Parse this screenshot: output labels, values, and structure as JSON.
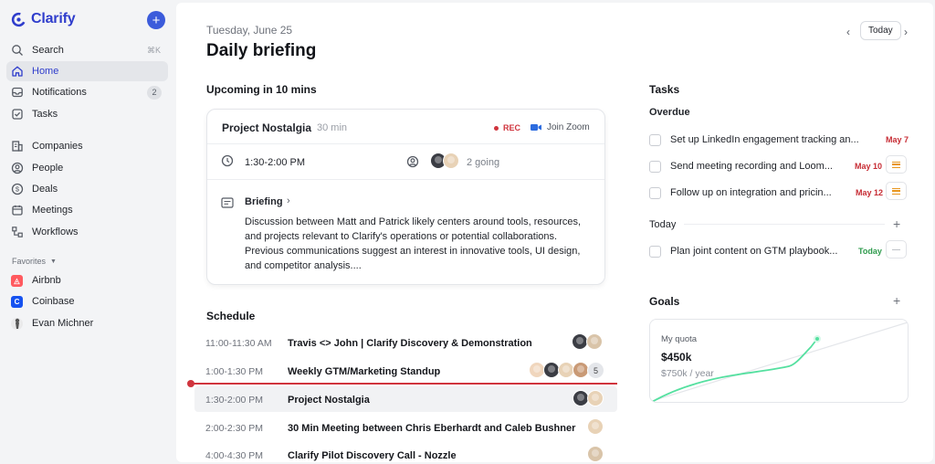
{
  "brand": {
    "name": "Clarify",
    "accent": "#2f3dcc"
  },
  "sidebar": {
    "add_label": "+",
    "items": [
      {
        "label": "Search",
        "icon": "search-icon",
        "shortcut": "⌘K"
      },
      {
        "label": "Home",
        "icon": "home-icon",
        "active": true
      },
      {
        "label": "Notifications",
        "icon": "inbox-icon",
        "badge": "2"
      },
      {
        "label": "Tasks",
        "icon": "checkbox-icon"
      },
      {
        "label": "Companies",
        "icon": "building-icon"
      },
      {
        "label": "People",
        "icon": "person-circle-icon"
      },
      {
        "label": "Deals",
        "icon": "dollar-icon"
      },
      {
        "label": "Meetings",
        "icon": "calendar-icon"
      },
      {
        "label": "Workflows",
        "icon": "workflow-icon"
      }
    ],
    "favorites_label": "Favorites",
    "favorites": [
      {
        "label": "Airbnb",
        "color": "#ff5a5f"
      },
      {
        "label": "Coinbase",
        "color": "#1652f0"
      },
      {
        "label": "Evan Michner"
      }
    ]
  },
  "header": {
    "date": "Tuesday, June 25",
    "title": "Daily briefing",
    "today_button": "Today",
    "prev": "‹",
    "next": "›"
  },
  "upcoming": {
    "heading": "Upcoming in 10 mins",
    "meeting_title": "Project Nostalgia",
    "duration": "30 min",
    "rec_label": "REC",
    "join_label": "Join Zoom",
    "time_range": "1:30-2:00 PM",
    "going": "2 going",
    "briefing_label": "Briefing",
    "briefing_text": "Discussion between Matt and Patrick likely centers around tools, resources, and projects relevant to Clarify's operations or potential collaborations. Previous communications suggest an interest in innovative tools, UI design, and competitor analysis...."
  },
  "schedule": {
    "heading": "Schedule",
    "rows": [
      {
        "time": "11:00-11:30 AM",
        "title": "Travis <> John | Clarify Discovery & Demonstration"
      },
      {
        "time": "1:00-1:30 PM",
        "title": "Weekly GTM/Marketing Standup",
        "extra_count": "5"
      },
      {
        "time": "1:30-2:00 PM",
        "title": "Project Nostalgia"
      },
      {
        "time": "2:00-2:30 PM",
        "title": "30 Min Meeting between Chris Eberhardt and Caleb Bushner"
      },
      {
        "time": "4:00-4:30 PM",
        "title": "Clarify Pilot Discovery Call - Nozzle"
      }
    ]
  },
  "tasks": {
    "heading": "Tasks",
    "overdue_label": "Overdue",
    "today_label": "Today",
    "overdue": [
      {
        "text": "Set up LinkedIn engagement tracking an...",
        "date": "May 7"
      },
      {
        "text": "Send meeting recording and Loom...",
        "date": "May 10"
      },
      {
        "text": "Follow up on integration and pricin...",
        "date": "May 12"
      }
    ],
    "today": [
      {
        "text": "Plan joint content on GTM playbook...",
        "date": "Today"
      }
    ]
  },
  "goals": {
    "heading": "Goals",
    "label": "My quota",
    "value": "$450k",
    "target": "$750k / year"
  }
}
